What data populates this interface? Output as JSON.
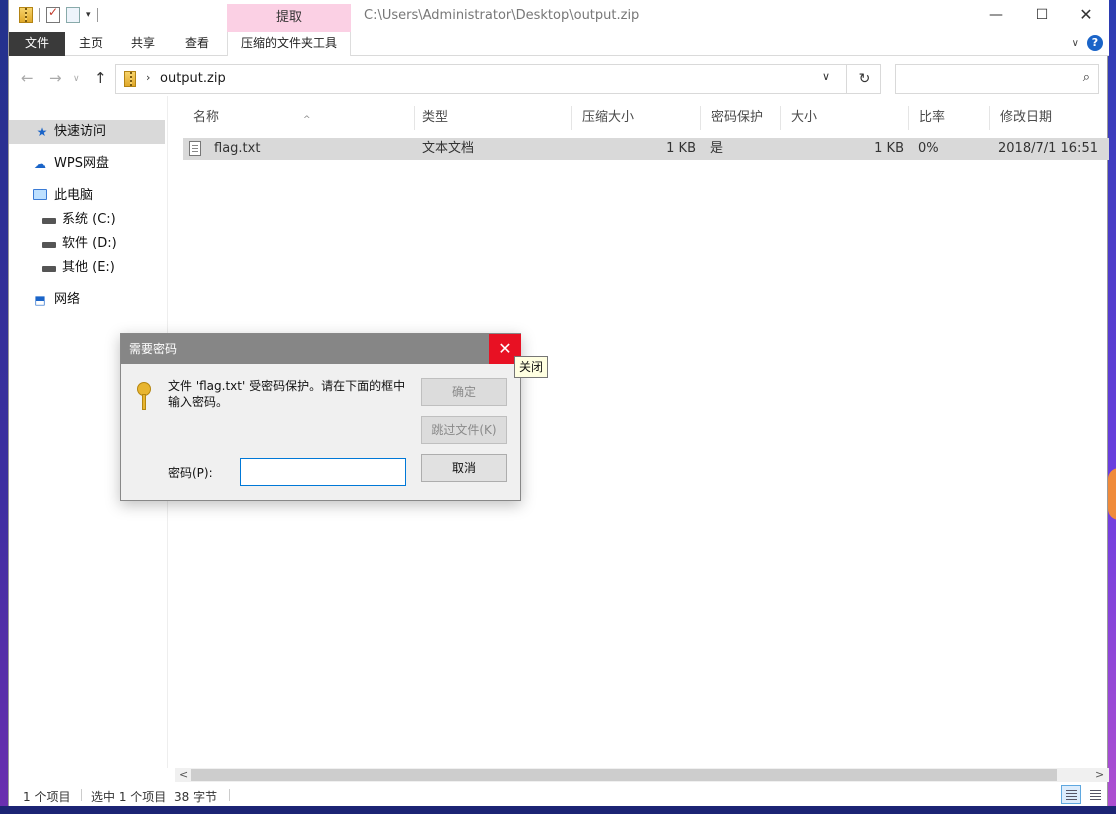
{
  "title_bar": {
    "extract_tab": "提取",
    "path": "C:\\Users\\Administrator\\Desktop\\output.zip",
    "min": "—",
    "max": "☐",
    "close": "✕"
  },
  "ribbon": {
    "file": "文件",
    "home": "主页",
    "share": "共享",
    "view": "查看",
    "tools": "压缩的文件夹工具",
    "collapse": "∨",
    "help": "?"
  },
  "address": {
    "back": "←",
    "forward": "→",
    "recent": "∨",
    "up": "↑",
    "crumb_sep": "›",
    "crumb": "output.zip",
    "dropdown": "∨",
    "refresh": "↻",
    "search_placeholder": "",
    "search_icon": "⌕"
  },
  "nav_pane": {
    "items": [
      {
        "label": "快速访问",
        "icon": "star-icon"
      },
      {
        "label": "WPS网盘",
        "icon": "cloud-icon"
      },
      {
        "label": "此电脑",
        "icon": "computer-icon"
      },
      {
        "label": "系统 (C:)",
        "icon": "drive-icon"
      },
      {
        "label": "软件 (D:)",
        "icon": "drive-icon"
      },
      {
        "label": "其他 (E:)",
        "icon": "drive-icon"
      },
      {
        "label": "网络",
        "icon": "network-icon"
      }
    ]
  },
  "columns": {
    "name": "名称",
    "type": "类型",
    "compressed_size": "压缩大小",
    "password": "密码保护",
    "size": "大小",
    "ratio": "比率",
    "modified": "修改日期",
    "sort_arrow": "^"
  },
  "files": [
    {
      "name": "flag.txt",
      "type": "文本文档",
      "compressed_size": "1 KB",
      "password": "是",
      "size": "1 KB",
      "ratio": "0%",
      "modified": "2018/7/1 16:51"
    }
  ],
  "scrollbar": {
    "left": "<",
    "right": ">"
  },
  "status": {
    "count": "1 个项目",
    "selected": "选中 1 个项目",
    "bytes": "38 字节"
  },
  "dialog": {
    "title": "需要密码",
    "close": "✕",
    "tooltip": "关闭",
    "message": "文件 'flag.txt' 受密码保护。请在下面的框中输入密码。",
    "ok": "确定",
    "skip": "跳过文件(K)",
    "cancel": "取消",
    "password_label": "密码(P):",
    "password_value": ""
  },
  "colors": {
    "extract_tab_bg": "#fbd0e4",
    "selection_bg": "#d9d9d9",
    "close_red": "#e81123",
    "input_border": "#0078d7"
  }
}
